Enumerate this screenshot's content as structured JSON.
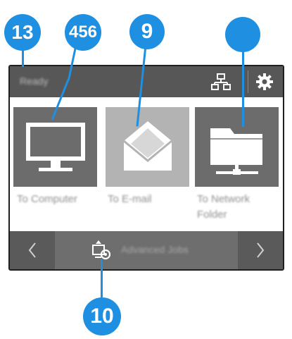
{
  "colors": {
    "callout": "#1e8fe1",
    "topbar": "#575757",
    "tile_dark": "#6c6c6c",
    "tile_light": "#b3b3b3",
    "bottombar": "#6a6a6a"
  },
  "callouts": {
    "c1": "13",
    "c2": "456",
    "c3": "9",
    "c4": "",
    "c5": "10"
  },
  "topbar": {
    "status": "Ready",
    "network_icon": "network-icon",
    "settings_icon": "gear-icon"
  },
  "tiles": [
    {
      "label": "To Computer",
      "icon": "monitor-icon"
    },
    {
      "label": "To E-mail",
      "icon": "envelope-icon"
    },
    {
      "label": "To Network\nFolder",
      "icon": "network-folder-icon"
    }
  ],
  "bottombar": {
    "prev": "‹",
    "next": "›",
    "advanced_label": "Advanced Jobs",
    "advanced_icon": "advanced-jobs-icon"
  }
}
